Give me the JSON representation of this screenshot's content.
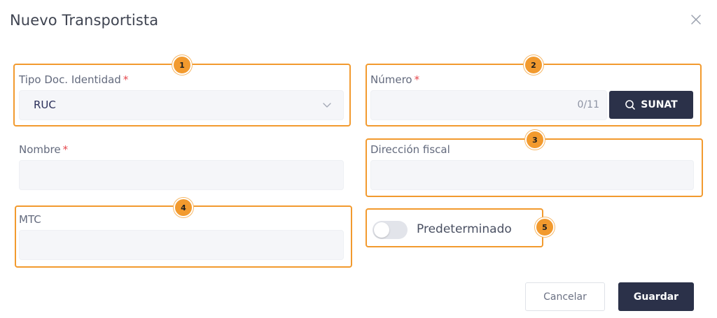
{
  "dialog": {
    "title": "Nuevo Transportista"
  },
  "form": {
    "tipo_doc": {
      "label": "Tipo Doc. Identidad",
      "required_mark": "*",
      "value": "RUC"
    },
    "numero": {
      "label": "Número",
      "required_mark": "*",
      "value": "",
      "counter": "0/11",
      "sunat_button": "SUNAT"
    },
    "nombre": {
      "label": "Nombre",
      "required_mark": "*",
      "value": ""
    },
    "direccion": {
      "label": "Dirección fiscal",
      "value": ""
    },
    "mtc": {
      "label": "MTC",
      "value": ""
    },
    "predeterminado": {
      "label": "Predeterminado",
      "checked": false
    }
  },
  "annotations": [
    "1",
    "2",
    "3",
    "4",
    "5"
  ],
  "footer": {
    "cancel_label": "Cancelar",
    "save_label": "Guardar"
  },
  "icons": {
    "close": "close-icon",
    "chevron": "chevron-down-icon",
    "search": "search-icon"
  },
  "colors": {
    "accent": "#f29a2e",
    "primary": "#2b3149",
    "required": "#e5484d",
    "field_bg": "#f5f6f9"
  }
}
